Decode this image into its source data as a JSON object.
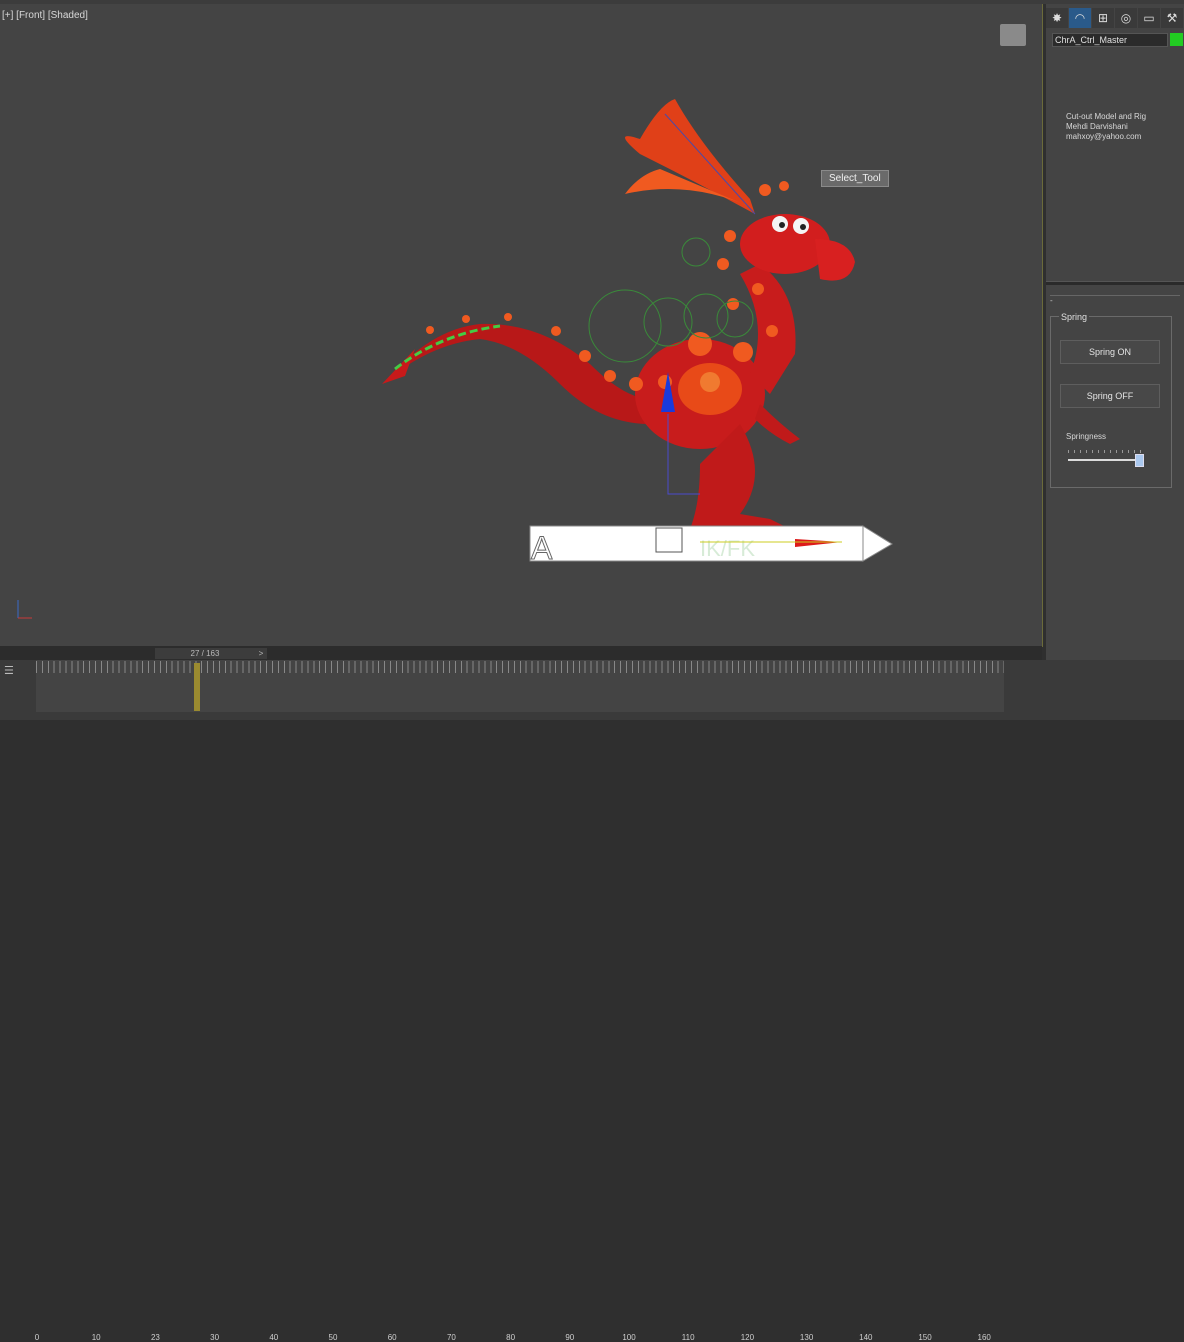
{
  "viewport": {
    "label": "[+] [Front] [Shaded]",
    "tooltip": "Select_Tool",
    "ik_fk_label": "IK/FK",
    "switch_letter": "A"
  },
  "command_panel": {
    "tab_icons": [
      "sun-icon",
      "modify-icon",
      "hierarchy-icon",
      "motion-icon",
      "display-icon",
      "utilities-icon"
    ],
    "object_name": "ChrA_Ctrl_Master",
    "object_color": "#22cc22",
    "credits": [
      "Cut-out Model and Rig",
      "Mehdi Darvishani",
      "mahxoy@yahoo.com"
    ],
    "rollout_toggle": "-",
    "spring": {
      "group_title": "Spring",
      "on_label": "Spring ON",
      "off_label": "Spring OFF",
      "springness_label": "Springness",
      "springness_value": 0.93
    }
  },
  "timeline": {
    "frame_indicator": "27 / 163",
    "next_label": ">",
    "current_frame": 27,
    "tick_labels": [
      "0",
      "10",
      "23",
      "30",
      "40",
      "50",
      "60",
      "70",
      "80",
      "90",
      "100",
      "110",
      "120",
      "130",
      "140",
      "150",
      "160"
    ]
  }
}
